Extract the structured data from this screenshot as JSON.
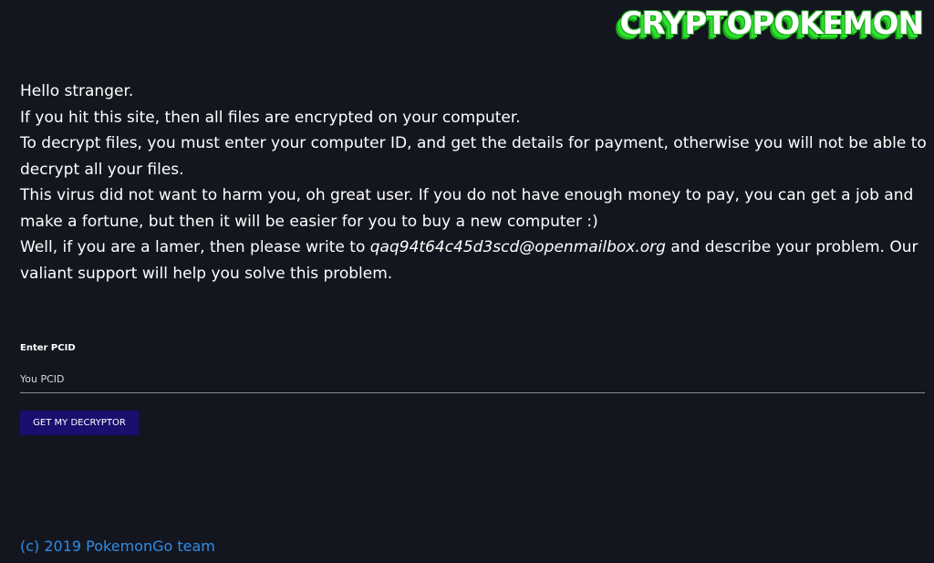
{
  "logo": {
    "text": "CRYPTOPOKEMON",
    "colors": {
      "fill": "#ffffff",
      "shadow": "#2fe02f"
    }
  },
  "message": {
    "greeting": "Hello stranger.",
    "line1": "If you hit this site, then all files are encrypted on your computer.",
    "line2": "To decrypt files, you must enter your computer ID, and get the details for payment, otherwise you will not be able to decrypt all your files.",
    "line3": "This virus did not want to harm you, oh great user. If you do not have enough money to pay, you can get a job and make a fortune, but then it will be easier for you to buy a new computer :)",
    "line4_prefix": "Well, if you are a lamer, then please write to ",
    "email": "qaq94t64c45d3scd@openmailbox.org",
    "line4_suffix": " and describe your problem. Our valiant support will help you solve this problem."
  },
  "form": {
    "label": "Enter PCID",
    "input_value": "",
    "input_placeholder": "You PCID",
    "button_label": "GET MY DECRYPTOR"
  },
  "footer": {
    "text": "(c) 2019 PokemonGo team"
  },
  "colors": {
    "background": "#14161f",
    "button": "#1a0f6e",
    "footer_link": "#2e8ce6"
  }
}
